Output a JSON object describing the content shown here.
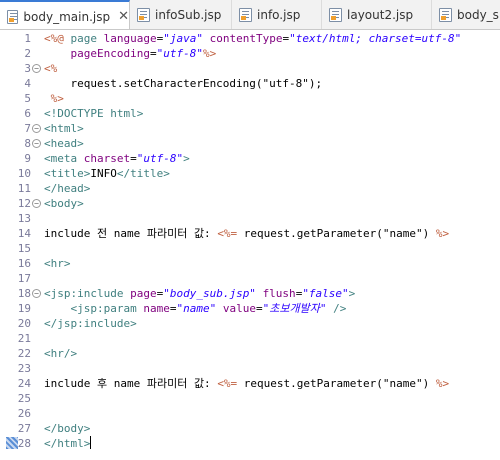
{
  "tabs": [
    {
      "label": "body_main.jsp",
      "active": true,
      "closable": true
    },
    {
      "label": "infoSub.jsp",
      "active": false
    },
    {
      "label": "info.jsp",
      "active": false
    },
    {
      "label": "layout2.jsp",
      "active": false
    },
    {
      "label": "body_s",
      "active": false
    }
  ],
  "tab_close_glyph": "✕",
  "colors": {
    "tag": "#3f7f7f",
    "attribute": "#7f007f",
    "value": "#2a00ff",
    "jsp_delimiter": "#bf5f3f",
    "active_tab_accent": "#3a7bd5"
  },
  "editor": {
    "lines": [
      {
        "num": "1",
        "fold": "",
        "tokens": [
          {
            "t": "<%@",
            "c": "jsp"
          },
          {
            "t": " page ",
            "c": "tag"
          },
          {
            "t": "language",
            "c": "attr"
          },
          {
            "t": "=",
            "c": "pl"
          },
          {
            "t": "\"java\"",
            "c": "val"
          },
          {
            "t": " ",
            "c": "pl"
          },
          {
            "t": "contentType",
            "c": "attr"
          },
          {
            "t": "=",
            "c": "pl"
          },
          {
            "t": "\"text/html; charset=utf-8\"",
            "c": "val"
          }
        ]
      },
      {
        "num": "2",
        "fold": "",
        "tokens": [
          {
            "t": "    ",
            "c": "pl"
          },
          {
            "t": "pageEncoding",
            "c": "attr"
          },
          {
            "t": "=",
            "c": "pl"
          },
          {
            "t": "\"utf-8\"",
            "c": "val"
          },
          {
            "t": "%>",
            "c": "jsp"
          }
        ]
      },
      {
        "num": "3",
        "fold": "minus",
        "tokens": [
          {
            "t": "<%",
            "c": "jsp"
          }
        ]
      },
      {
        "num": "4",
        "fold": "",
        "tokens": [
          {
            "t": "    request.setCharacterEncoding(\"utf-8\");",
            "c": "pl"
          }
        ]
      },
      {
        "num": "5",
        "fold": "",
        "tokens": [
          {
            "t": " %>",
            "c": "jsp"
          }
        ]
      },
      {
        "num": "6",
        "fold": "",
        "tokens": [
          {
            "t": "<!DOCTYPE html>",
            "c": "doc"
          }
        ]
      },
      {
        "num": "7",
        "fold": "minus",
        "tokens": [
          {
            "t": "<html>",
            "c": "tag"
          }
        ]
      },
      {
        "num": "8",
        "fold": "minus",
        "tokens": [
          {
            "t": "<head>",
            "c": "tag"
          }
        ]
      },
      {
        "num": "9",
        "fold": "",
        "tokens": [
          {
            "t": "<meta ",
            "c": "tag"
          },
          {
            "t": "charset",
            "c": "attr"
          },
          {
            "t": "=",
            "c": "pl"
          },
          {
            "t": "\"utf-8\"",
            "c": "val"
          },
          {
            "t": ">",
            "c": "tag"
          }
        ]
      },
      {
        "num": "10",
        "fold": "",
        "tokens": [
          {
            "t": "<title>",
            "c": "tag"
          },
          {
            "t": "INFO",
            "c": "pl"
          },
          {
            "t": "</title>",
            "c": "tag"
          }
        ]
      },
      {
        "num": "11",
        "fold": "",
        "tokens": [
          {
            "t": "</head>",
            "c": "tag"
          }
        ]
      },
      {
        "num": "12",
        "fold": "minus",
        "tokens": [
          {
            "t": "<body>",
            "c": "tag"
          }
        ]
      },
      {
        "num": "13",
        "fold": "",
        "tokens": []
      },
      {
        "num": "14",
        "fold": "",
        "tokens": [
          {
            "t": "include 전 name 파라미터 값: ",
            "c": "pl"
          },
          {
            "t": "<%=",
            "c": "jsp"
          },
          {
            "t": " request.getParameter(\"name\") ",
            "c": "pl"
          },
          {
            "t": "%>",
            "c": "jsp"
          }
        ]
      },
      {
        "num": "15",
        "fold": "",
        "tokens": []
      },
      {
        "num": "16",
        "fold": "",
        "tokens": [
          {
            "t": "<hr>",
            "c": "tag"
          }
        ]
      },
      {
        "num": "17",
        "fold": "",
        "tokens": []
      },
      {
        "num": "18",
        "fold": "minus",
        "tokens": [
          {
            "t": "<jsp:include ",
            "c": "tag"
          },
          {
            "t": "page",
            "c": "attr"
          },
          {
            "t": "=",
            "c": "pl"
          },
          {
            "t": "\"body_sub.jsp\"",
            "c": "val"
          },
          {
            "t": " ",
            "c": "pl"
          },
          {
            "t": "flush",
            "c": "attr"
          },
          {
            "t": "=",
            "c": "pl"
          },
          {
            "t": "\"false\"",
            "c": "val"
          },
          {
            "t": ">",
            "c": "tag"
          }
        ]
      },
      {
        "num": "19",
        "fold": "",
        "tokens": [
          {
            "t": "    ",
            "c": "pl"
          },
          {
            "t": "<jsp:param ",
            "c": "tag"
          },
          {
            "t": "name",
            "c": "attr"
          },
          {
            "t": "=",
            "c": "pl"
          },
          {
            "t": "\"name\"",
            "c": "val"
          },
          {
            "t": " ",
            "c": "pl"
          },
          {
            "t": "value",
            "c": "attr"
          },
          {
            "t": "=",
            "c": "pl"
          },
          {
            "t": "\"초보개발자\"",
            "c": "val"
          },
          {
            "t": " />",
            "c": "tag"
          }
        ]
      },
      {
        "num": "20",
        "fold": "",
        "tokens": [
          {
            "t": "</jsp:include>",
            "c": "tag"
          }
        ]
      },
      {
        "num": "21",
        "fold": "",
        "tokens": []
      },
      {
        "num": "22",
        "fold": "",
        "tokens": [
          {
            "t": "<hr/>",
            "c": "tag"
          }
        ]
      },
      {
        "num": "23",
        "fold": "",
        "tokens": []
      },
      {
        "num": "24",
        "fold": "",
        "tokens": [
          {
            "t": "include 후 name 파라미터 값: ",
            "c": "pl"
          },
          {
            "t": "<%=",
            "c": "jsp"
          },
          {
            "t": " request.getParameter(\"name\") ",
            "c": "pl"
          },
          {
            "t": "%>",
            "c": "jsp"
          }
        ]
      },
      {
        "num": "25",
        "fold": "",
        "tokens": []
      },
      {
        "num": "26",
        "fold": "",
        "tokens": []
      },
      {
        "num": "27",
        "fold": "",
        "tokens": [
          {
            "t": "</body>",
            "c": "tag"
          }
        ]
      },
      {
        "num": "28",
        "fold": "",
        "marker": true,
        "caret": true,
        "tokens": [
          {
            "t": "</html>",
            "c": "tag"
          }
        ]
      }
    ]
  }
}
